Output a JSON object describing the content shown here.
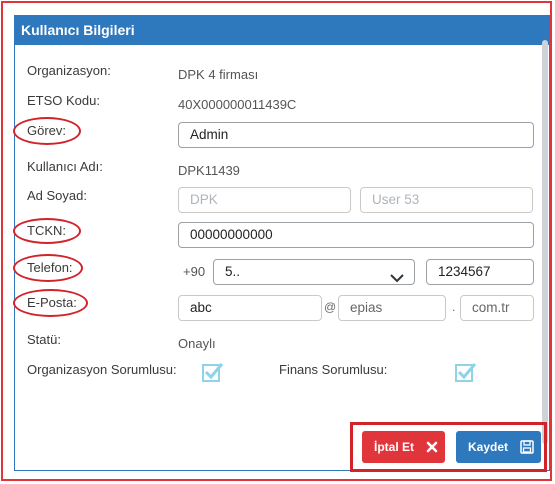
{
  "panel": {
    "title": "Kullanıcı Bilgileri"
  },
  "fields": {
    "organizasyon": {
      "label": "Organizasyon:",
      "value": "DPK 4 firması"
    },
    "etso": {
      "label": "ETSO Kodu:",
      "value": "40X000000011439C"
    },
    "gorev": {
      "label": "Görev:",
      "value": "Admin"
    },
    "kullanici_adi": {
      "label": "Kullanıcı Adı:",
      "value": "DPK11439"
    },
    "ad_soyad": {
      "label": "Ad Soyad:",
      "first_placeholder": "DPK",
      "last_placeholder": "User 53"
    },
    "tckn": {
      "label": "TCKN:",
      "value": "00000000000"
    },
    "telefon": {
      "label": "Telefon:",
      "country_code": "+90",
      "area_code": "5..",
      "number": "1234567"
    },
    "eposta": {
      "label": "E-Posta:",
      "user": "abc",
      "at": "@",
      "domain": "epias",
      "dot": ".",
      "tld": "com.tr"
    },
    "statu": {
      "label": "Statü:",
      "value": "Onaylı"
    },
    "org_sorumlusu": {
      "label": "Organizasyon Sorumlusu:",
      "checked": true
    },
    "finans_sorumlusu": {
      "label": "Finans Sorumlusu:",
      "checked": true
    }
  },
  "buttons": {
    "cancel_label": "İptal Et",
    "save_label": "Kaydet"
  },
  "colors": {
    "header": "#2e78be",
    "cancel": "#e0353b",
    "annotation": "#d1232a",
    "check": "#8fd3ea"
  },
  "icons": {
    "cancel": "close-icon",
    "save": "floppy-disk-icon",
    "select": "chevron-down-icon",
    "checkbox": "checkmark-icon"
  }
}
